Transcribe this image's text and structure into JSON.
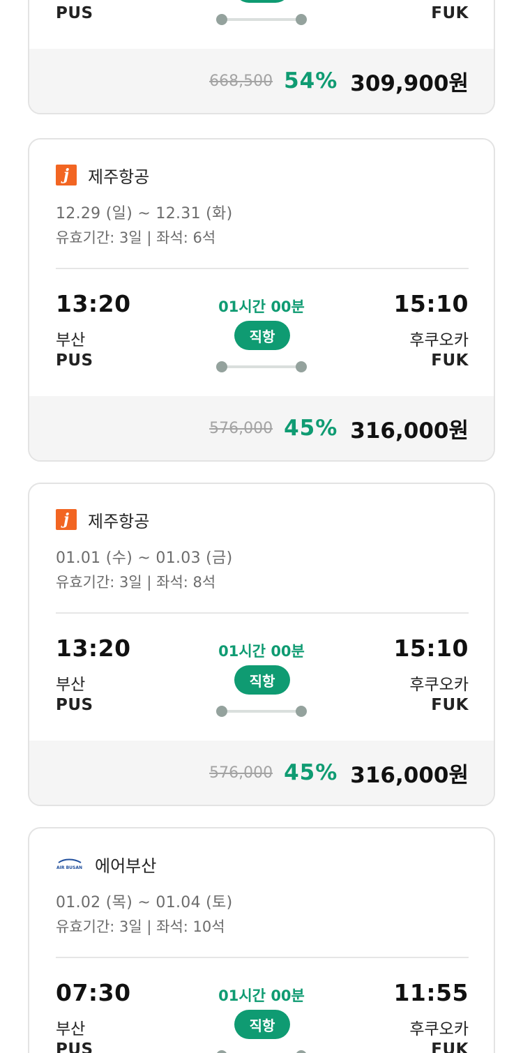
{
  "cards": [
    {
      "airline": "",
      "dates": "",
      "validity": "",
      "dep_time": "",
      "arr_time": "",
      "duration": "",
      "direct_label": "",
      "dep_city": "",
      "arr_city": "",
      "dep_code": "PUS",
      "arr_code": "FUK",
      "original_price": "668,500",
      "discount": "54%",
      "final_price": "309,900원"
    },
    {
      "airline": "제주항공",
      "logo": "jeju-air-logo",
      "logo_letter": "j",
      "dates": "12.29 (일) ~ 12.31 (화)",
      "validity": "유효기간: 3일 | 좌석: 6석",
      "dep_time": "13:20",
      "arr_time": "15:10",
      "duration": "01시간 00분",
      "direct_label": "직항",
      "dep_city": "부산",
      "arr_city": "후쿠오카",
      "dep_code": "PUS",
      "arr_code": "FUK",
      "original_price": "576,000",
      "discount": "45%",
      "final_price": "316,000원"
    },
    {
      "airline": "제주항공",
      "logo": "jeju-air-logo",
      "logo_letter": "j",
      "dates": "01.01 (수) ~ 01.03 (금)",
      "validity": "유효기간: 3일 | 좌석: 8석",
      "dep_time": "13:20",
      "arr_time": "15:10",
      "duration": "01시간 00분",
      "direct_label": "직항",
      "dep_city": "부산",
      "arr_city": "후쿠오카",
      "dep_code": "PUS",
      "arr_code": "FUK",
      "original_price": "576,000",
      "discount": "45%",
      "final_price": "316,000원"
    },
    {
      "airline": "에어부산",
      "logo": "air-busan-logo",
      "logo_text": "AIR BUSAN",
      "dates": "01.02 (목) ~ 01.04 (토)",
      "validity": "유효기간: 3일 | 좌석: 10석",
      "dep_time": "07:30",
      "arr_time": "11:55",
      "duration": "01시간 00분",
      "direct_label": "직항",
      "dep_city": "부산",
      "arr_city": "후쿠오카",
      "dep_code": "PUS",
      "arr_code": "FUK"
    }
  ],
  "colors": {
    "accent": "#0f9b72",
    "jeju": "#f26522",
    "busan": "#1f4e9c"
  }
}
